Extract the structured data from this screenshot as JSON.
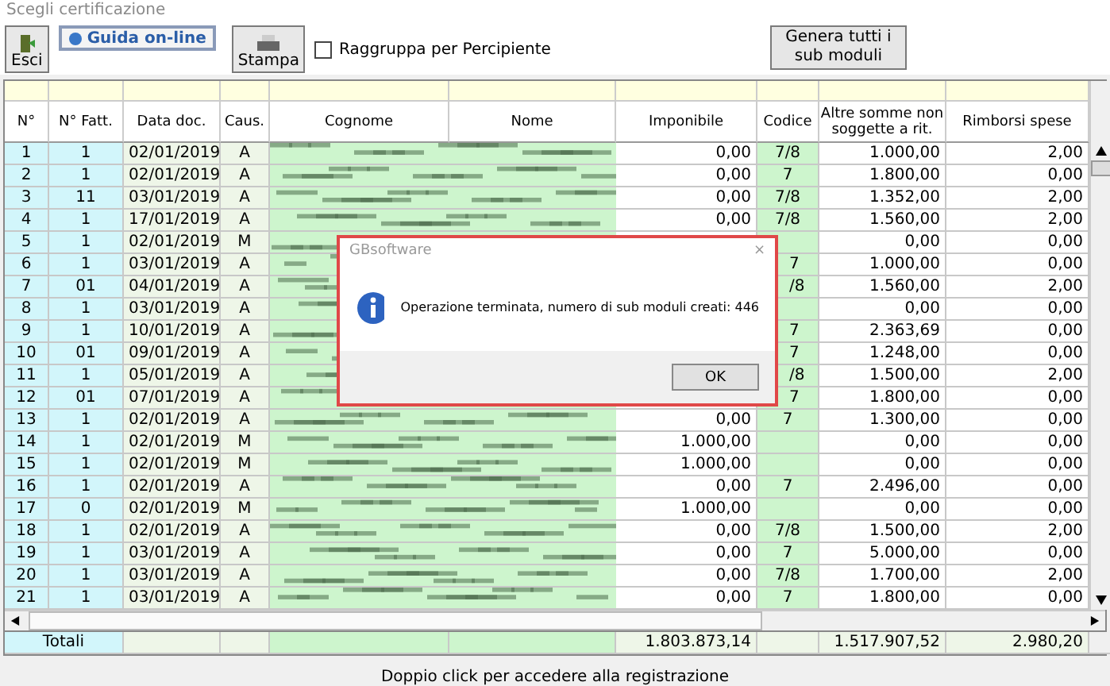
{
  "window": {
    "title": "Scegli certificazione"
  },
  "toolbar": {
    "exit": "Esci",
    "help": "Guida on-line",
    "print": "Stampa",
    "group_checkbox": {
      "label": "Raggruppa per Percipiente",
      "checked": false
    },
    "generate": "Genera tutti i sub moduli"
  },
  "table": {
    "columns": [
      "N°",
      "N° Fatt.",
      "Data doc.",
      "Caus.",
      "Cognome",
      "Nome",
      "Imponibile",
      "Codice",
      "Altre somme non soggette a rit.",
      "Rimborsi spese"
    ],
    "rows": [
      {
        "n": "1",
        "fatt": "1",
        "data": "02/01/2019",
        "caus": "A",
        "imponibile": "0,00",
        "codice": "7/8",
        "altre": "1.000,00",
        "rimborsi": "2,00"
      },
      {
        "n": "2",
        "fatt": "1",
        "data": "02/01/2019",
        "caus": "A",
        "imponibile": "0,00",
        "codice": "7",
        "altre": "1.800,00",
        "rimborsi": "0,00"
      },
      {
        "n": "3",
        "fatt": "11",
        "data": "03/01/2019",
        "caus": "A",
        "imponibile": "0,00",
        "codice": "7/8",
        "altre": "1.352,00",
        "rimborsi": "2,00"
      },
      {
        "n": "4",
        "fatt": "1",
        "data": "17/01/2019",
        "caus": "A",
        "imponibile": "0,00",
        "codice": "7/8",
        "altre": "1.560,00",
        "rimborsi": "2,00"
      },
      {
        "n": "5",
        "fatt": "1",
        "data": "02/01/2019",
        "caus": "M",
        "altre": "0,00",
        "rimborsi": "0,00"
      },
      {
        "n": "6",
        "fatt": "1",
        "data": "03/01/2019",
        "caus": "A",
        "codice": "7",
        "altre": "1.000,00",
        "rimborsi": "0,00"
      },
      {
        "n": "7",
        "fatt": "01",
        "data": "04/01/2019",
        "caus": "A",
        "codice": "/8",
        "altre": "1.560,00",
        "rimborsi": "2,00"
      },
      {
        "n": "8",
        "fatt": "1",
        "data": "03/01/2019",
        "caus": "A",
        "altre": "0,00",
        "rimborsi": "0,00"
      },
      {
        "n": "9",
        "fatt": "1",
        "data": "10/01/2019",
        "caus": "A",
        "codice": "7",
        "altre": "2.363,69",
        "rimborsi": "0,00"
      },
      {
        "n": "10",
        "fatt": "01",
        "data": "09/01/2019",
        "caus": "A",
        "codice": "7",
        "altre": "1.248,00",
        "rimborsi": "0,00"
      },
      {
        "n": "11",
        "fatt": "1",
        "data": "05/01/2019",
        "caus": "A",
        "codice": "/8",
        "altre": "1.500,00",
        "rimborsi": "2,00"
      },
      {
        "n": "12",
        "fatt": "01",
        "data": "07/01/2019",
        "caus": "A",
        "codice": "7",
        "altre": "1.800,00",
        "rimborsi": "0,00"
      },
      {
        "n": "13",
        "fatt": "1",
        "data": "02/01/2019",
        "caus": "A",
        "imponibile": "0,00",
        "codice": "7",
        "altre": "1.300,00",
        "rimborsi": "0,00"
      },
      {
        "n": "14",
        "fatt": "1",
        "data": "02/01/2019",
        "caus": "M",
        "imponibile": "1.000,00",
        "altre": "0,00",
        "rimborsi": "0,00"
      },
      {
        "n": "15",
        "fatt": "1",
        "data": "02/01/2019",
        "caus": "M",
        "imponibile": "1.000,00",
        "altre": "0,00",
        "rimborsi": "0,00"
      },
      {
        "n": "16",
        "fatt": "1",
        "data": "02/01/2019",
        "caus": "A",
        "imponibile": "0,00",
        "codice": "7",
        "altre": "2.496,00",
        "rimborsi": "0,00"
      },
      {
        "n": "17",
        "fatt": "0",
        "data": "02/01/2019",
        "caus": "M",
        "imponibile": "1.000,00",
        "altre": "0,00",
        "rimborsi": "0,00"
      },
      {
        "n": "18",
        "fatt": "1",
        "data": "02/01/2019",
        "caus": "A",
        "imponibile": "0,00",
        "codice": "7/8",
        "altre": "1.500,00",
        "rimborsi": "2,00"
      },
      {
        "n": "19",
        "fatt": "1",
        "data": "03/01/2019",
        "caus": "A",
        "imponibile": "0,00",
        "codice": "7",
        "altre": "5.000,00",
        "rimborsi": "0,00"
      },
      {
        "n": "20",
        "fatt": "1",
        "data": "03/01/2019",
        "caus": "A",
        "imponibile": "0,00",
        "codice": "7/8",
        "altre": "1.700,00",
        "rimborsi": "2,00"
      },
      {
        "n": "21",
        "fatt": "1",
        "data": "03/01/2019",
        "caus": "A",
        "imponibile": "0,00",
        "codice": "7",
        "altre": "1.800,00",
        "rimborsi": "0,00"
      }
    ],
    "totals": {
      "label": "Totali",
      "imponibile": "1.803.873,14",
      "altre": "1.517.907,52",
      "rimborsi": "2.980,20"
    }
  },
  "status_text": "Doppio click per accedere alla registrazione",
  "dialog": {
    "title": "GBsoftware",
    "close": "×",
    "message": "Operazione terminata, numero di sub moduli creati: 446",
    "button": "OK"
  }
}
